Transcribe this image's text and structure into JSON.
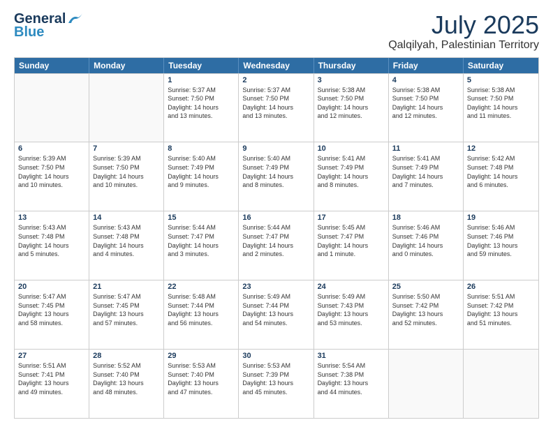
{
  "header": {
    "logo_line1": "General",
    "logo_line2": "Blue",
    "month_year": "July 2025",
    "location": "Qalqilyah, Palestinian Territory"
  },
  "weekdays": [
    "Sunday",
    "Monday",
    "Tuesday",
    "Wednesday",
    "Thursday",
    "Friday",
    "Saturday"
  ],
  "rows": [
    [
      {
        "day": "",
        "info": ""
      },
      {
        "day": "",
        "info": ""
      },
      {
        "day": "1",
        "info": "Sunrise: 5:37 AM\nSunset: 7:50 PM\nDaylight: 14 hours\nand 13 minutes."
      },
      {
        "day": "2",
        "info": "Sunrise: 5:37 AM\nSunset: 7:50 PM\nDaylight: 14 hours\nand 13 minutes."
      },
      {
        "day": "3",
        "info": "Sunrise: 5:38 AM\nSunset: 7:50 PM\nDaylight: 14 hours\nand 12 minutes."
      },
      {
        "day": "4",
        "info": "Sunrise: 5:38 AM\nSunset: 7:50 PM\nDaylight: 14 hours\nand 12 minutes."
      },
      {
        "day": "5",
        "info": "Sunrise: 5:38 AM\nSunset: 7:50 PM\nDaylight: 14 hours\nand 11 minutes."
      }
    ],
    [
      {
        "day": "6",
        "info": "Sunrise: 5:39 AM\nSunset: 7:50 PM\nDaylight: 14 hours\nand 10 minutes."
      },
      {
        "day": "7",
        "info": "Sunrise: 5:39 AM\nSunset: 7:50 PM\nDaylight: 14 hours\nand 10 minutes."
      },
      {
        "day": "8",
        "info": "Sunrise: 5:40 AM\nSunset: 7:49 PM\nDaylight: 14 hours\nand 9 minutes."
      },
      {
        "day": "9",
        "info": "Sunrise: 5:40 AM\nSunset: 7:49 PM\nDaylight: 14 hours\nand 8 minutes."
      },
      {
        "day": "10",
        "info": "Sunrise: 5:41 AM\nSunset: 7:49 PM\nDaylight: 14 hours\nand 8 minutes."
      },
      {
        "day": "11",
        "info": "Sunrise: 5:41 AM\nSunset: 7:49 PM\nDaylight: 14 hours\nand 7 minutes."
      },
      {
        "day": "12",
        "info": "Sunrise: 5:42 AM\nSunset: 7:48 PM\nDaylight: 14 hours\nand 6 minutes."
      }
    ],
    [
      {
        "day": "13",
        "info": "Sunrise: 5:43 AM\nSunset: 7:48 PM\nDaylight: 14 hours\nand 5 minutes."
      },
      {
        "day": "14",
        "info": "Sunrise: 5:43 AM\nSunset: 7:48 PM\nDaylight: 14 hours\nand 4 minutes."
      },
      {
        "day": "15",
        "info": "Sunrise: 5:44 AM\nSunset: 7:47 PM\nDaylight: 14 hours\nand 3 minutes."
      },
      {
        "day": "16",
        "info": "Sunrise: 5:44 AM\nSunset: 7:47 PM\nDaylight: 14 hours\nand 2 minutes."
      },
      {
        "day": "17",
        "info": "Sunrise: 5:45 AM\nSunset: 7:47 PM\nDaylight: 14 hours\nand 1 minute."
      },
      {
        "day": "18",
        "info": "Sunrise: 5:46 AM\nSunset: 7:46 PM\nDaylight: 14 hours\nand 0 minutes."
      },
      {
        "day": "19",
        "info": "Sunrise: 5:46 AM\nSunset: 7:46 PM\nDaylight: 13 hours\nand 59 minutes."
      }
    ],
    [
      {
        "day": "20",
        "info": "Sunrise: 5:47 AM\nSunset: 7:45 PM\nDaylight: 13 hours\nand 58 minutes."
      },
      {
        "day": "21",
        "info": "Sunrise: 5:47 AM\nSunset: 7:45 PM\nDaylight: 13 hours\nand 57 minutes."
      },
      {
        "day": "22",
        "info": "Sunrise: 5:48 AM\nSunset: 7:44 PM\nDaylight: 13 hours\nand 56 minutes."
      },
      {
        "day": "23",
        "info": "Sunrise: 5:49 AM\nSunset: 7:44 PM\nDaylight: 13 hours\nand 54 minutes."
      },
      {
        "day": "24",
        "info": "Sunrise: 5:49 AM\nSunset: 7:43 PM\nDaylight: 13 hours\nand 53 minutes."
      },
      {
        "day": "25",
        "info": "Sunrise: 5:50 AM\nSunset: 7:42 PM\nDaylight: 13 hours\nand 52 minutes."
      },
      {
        "day": "26",
        "info": "Sunrise: 5:51 AM\nSunset: 7:42 PM\nDaylight: 13 hours\nand 51 minutes."
      }
    ],
    [
      {
        "day": "27",
        "info": "Sunrise: 5:51 AM\nSunset: 7:41 PM\nDaylight: 13 hours\nand 49 minutes."
      },
      {
        "day": "28",
        "info": "Sunrise: 5:52 AM\nSunset: 7:40 PM\nDaylight: 13 hours\nand 48 minutes."
      },
      {
        "day": "29",
        "info": "Sunrise: 5:53 AM\nSunset: 7:40 PM\nDaylight: 13 hours\nand 47 minutes."
      },
      {
        "day": "30",
        "info": "Sunrise: 5:53 AM\nSunset: 7:39 PM\nDaylight: 13 hours\nand 45 minutes."
      },
      {
        "day": "31",
        "info": "Sunrise: 5:54 AM\nSunset: 7:38 PM\nDaylight: 13 hours\nand 44 minutes."
      },
      {
        "day": "",
        "info": ""
      },
      {
        "day": "",
        "info": ""
      }
    ]
  ]
}
